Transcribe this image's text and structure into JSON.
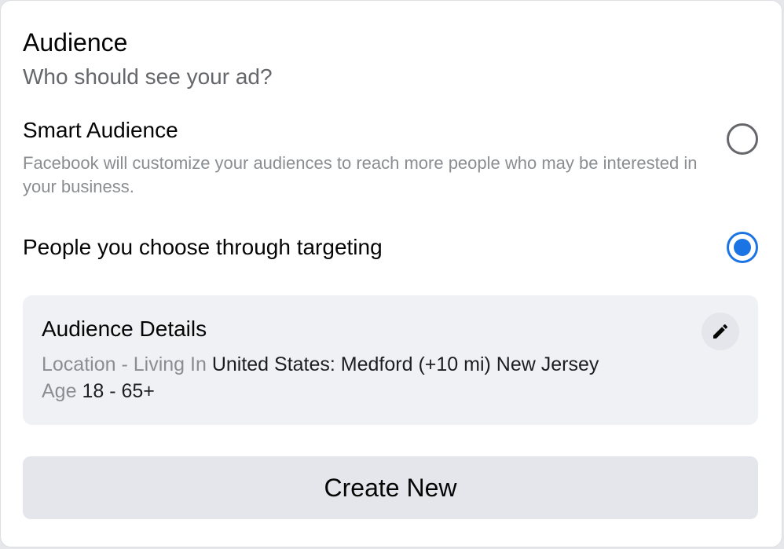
{
  "audience": {
    "title": "Audience",
    "subtitle": "Who should see your ad?"
  },
  "options": [
    {
      "label": "Smart Audience",
      "description": "Facebook will customize your audiences to reach more people who may be interested in your business.",
      "selected": false
    },
    {
      "label": "People you choose through targeting",
      "selected": true
    }
  ],
  "details": {
    "title": "Audience Details",
    "location_key": "Location - Living In",
    "location_value": "United States: Medford (+10 mi) New Jersey",
    "age_key": "Age",
    "age_value": "18 - 65+",
    "edit_icon": "pencil-icon"
  },
  "create_button": {
    "label": "Create New"
  },
  "colors": {
    "accent": "#1b74e4",
    "text_primary": "#050505",
    "text_secondary": "#65676b",
    "details_bg": "#f0f1f4",
    "button_bg": "#e4e6eb"
  }
}
